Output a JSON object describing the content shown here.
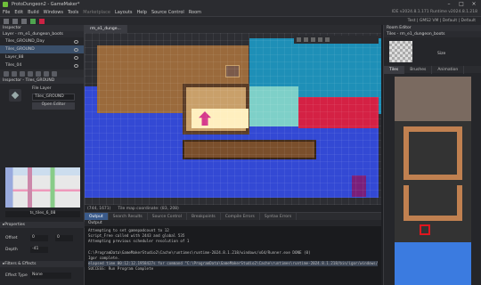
{
  "title": "ProtoDungeon2 - GameMaker*",
  "menu": [
    "File",
    "Edit",
    "Build",
    "Windows",
    "Tools",
    "Marketplace",
    "Layouts",
    "Help",
    "Source Control",
    "Room"
  ],
  "top_right_info": "IDE v2024.8.1.171 Runtime v2024.8.1.218",
  "target_info": "Test | GMS2 VM | Default | Default",
  "inspector": {
    "title": "Inspector",
    "layer_header": "Layer - rm_e1_dungeon_boots",
    "layers": [
      "Tiles_GROUND_Day",
      "Tiles_GROUND",
      "Layer_88",
      "Tiles_04"
    ],
    "inspector2_title": "Inspector - Tiles_GROUND",
    "file_layer_label": "File Layer",
    "tileset_value": "Tiles_GROUND",
    "open_editor_label": "Open Editor",
    "tileset_name": "ts_tiles_6_08",
    "properties_label": "Properties",
    "offset_label": "Offset",
    "offset_x": "0",
    "offset_y": "0",
    "depth_label": "Depth",
    "depth_value": "-41",
    "filters_label": "Filters & Effects",
    "effect_type_label": "Effect Type",
    "effect_type_value": "None"
  },
  "room_tab": "rm_e1_dunge...",
  "status": {
    "coords": "(744, 1671)",
    "tilemap": "Tile map coordinate: (83, 208)"
  },
  "output": {
    "tabs": [
      "Output",
      "Search Results",
      "Source Control",
      "Breakpoints",
      "Compile Errors",
      "Syntax Errors"
    ],
    "sub": "Output",
    "lines": [
      "Attempting to set gamepadcount to 12",
      "Script_Free called with 2443 and global 535",
      "Attempting previous scheduler resolution of 1",
      "",
      "C:\\ProgramData\\GameMakerStudio2\\Cache\\runtimes\\runtime-2024.8.1.218/windows/x64/Runner.exe DONE (0)",
      "Igor complete.",
      "elapsed time 00:12:12.1958427s for command \"C:\\ProgramData\\GameMakerStudio2\\Cache\\runtimes\\runtime-2024.8.1.218/bin/igor/windows/",
      "SUCCESS: Run Program Complete"
    ]
  },
  "room_editor": {
    "title": "Room Editor",
    "tile_header": "Tiles - rm_e1_dungeon_boots",
    "size_label": "Size",
    "tabs": [
      "Tiles",
      "Brushes",
      "Animation"
    ]
  }
}
